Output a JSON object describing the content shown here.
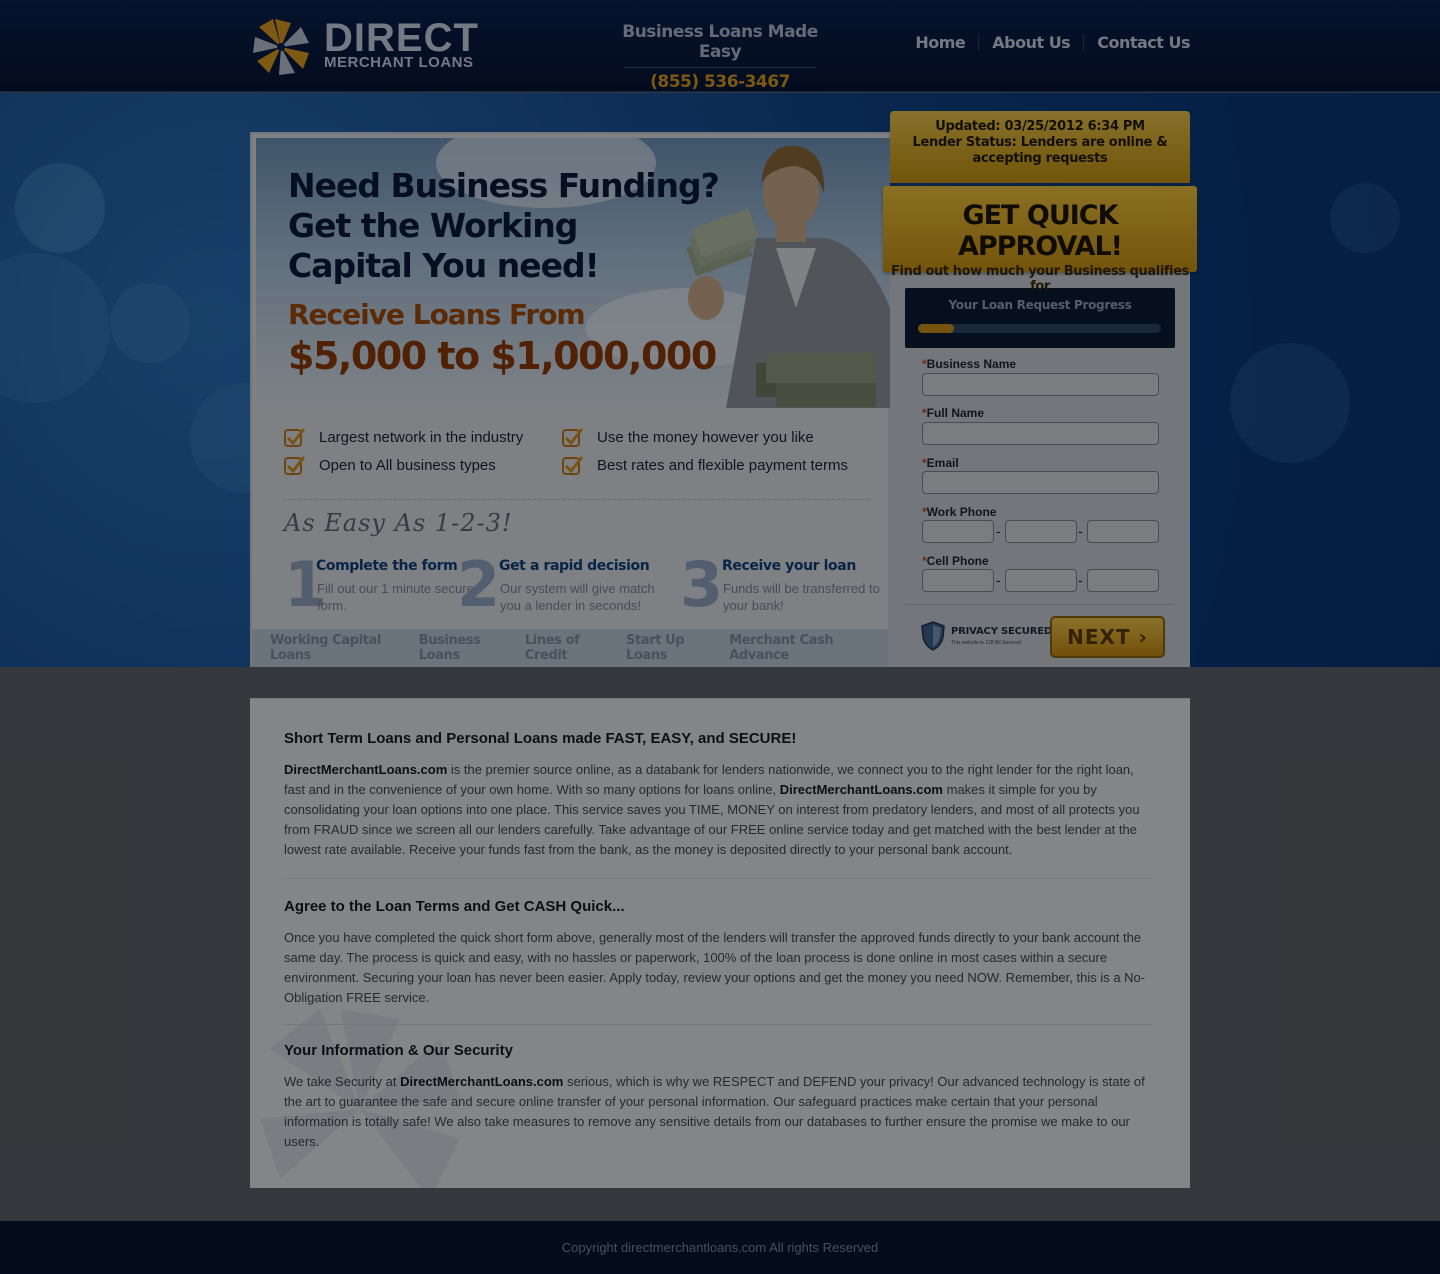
{
  "header": {
    "logo_title": "DIRECT",
    "logo_subtitle": "MERCHANT LOANS",
    "tagline": "Business Loans Made Easy",
    "phone": "(855) 536-3467",
    "nav": [
      "Home",
      "About Us",
      "Contact Us"
    ]
  },
  "hero": {
    "headline_1": "Need Business Funding?",
    "headline_2": "Get the Working",
    "headline_3": "Capital You need!",
    "receive": "Receive Loans From",
    "amount": "$5,000 to $1,000,000",
    "features": [
      "Largest network in the industry",
      "Use the money however you like",
      "Open to All business types",
      "Best rates and flexible payment terms"
    ],
    "easy": "As Easy As 1-2-3!",
    "steps": [
      {
        "num": "1",
        "title": "Complete the form",
        "desc": "Fill out our 1 minute secure form."
      },
      {
        "num": "2",
        "title": "Get a rapid decision",
        "desc": "Our system will give match you a lender in seconds!"
      },
      {
        "num": "3",
        "title": "Receive your loan",
        "desc": "Funds will be transferred to your bank!"
      }
    ],
    "loan_types": [
      "Working Capital Loans",
      "Business Loans",
      "Lines of Credit",
      "Start Up Loans",
      "Merchant Cash Advance"
    ]
  },
  "status": {
    "updated": "Updated: 03/25/2012 6:34 PM",
    "lender_1": "Lender Status: Lenders are online &",
    "lender_2": "accepting requests"
  },
  "approval": {
    "title": "GET QUICK APPROVAL!",
    "subtitle": "Find out how much your Business qualifies for"
  },
  "form": {
    "progress_title": "Your Loan Request Progress",
    "progress_value": 0.15,
    "required_mark": "*",
    "fields": {
      "business_name": "Business Name",
      "full_name": "Full Name",
      "email": "Email",
      "work_phone": "Work Phone",
      "cell_phone": "Cell Phone"
    },
    "phone_sep": "-",
    "privacy_title": "PRIVACY SECURED",
    "privacy_sub": "This website is 128 Bit Secured",
    "next_label": "NEXT ›"
  },
  "content": {
    "s1_title": "Short Term Loans and Personal Loans made FAST, EASY, and SECURE!",
    "site": "DirectMerchantLoans.com",
    "s1_p1": " is the premier source online, as a databank for lenders nationwide, we connect you to the right lender for the right loan, fast and in the convenience of your own home. With so many options for loans online, ",
    "s1_p2": " makes it simple for you by consolidating your loan options into one place. This service saves you TIME, MONEY on interest from predatory lenders, and most of all protects you from FRAUD since we screen all our lenders carefully. Take advantage of our FREE online service today and get matched with the best lender at the lowest rate available.  Receive your funds fast from the bank, as the money is deposited directly to your personal bank account.",
    "s2_title": "Agree to the Loan Terms and Get CASH Quick...",
    "s2_p": "Once you have completed the quick short form above, generally most of the lenders will transfer the approved funds directly to your bank account the same day. The process is quick and easy, with no hassles or paperwork, 100% of the loan process is done online in most cases within a secure environment. Securing your loan has never been easier. Apply today, review your options and get the money you need NOW. Remember, this is a No-Obligation FREE service.",
    "s3_title": "Your Information & Our Security",
    "s3_p1": "We take Security at ",
    "s3_p2": " serious, which is why we RESPECT and DEFEND your privacy! Our advanced technology is state of the art to guarantee the safe and secure online transfer of your personal information. Our safeguard practices make certain that your personal information is totally safe! We also take measures to remove any sensitive details from our databases to further ensure the promise we make to our users."
  },
  "footer": {
    "copyright": "Copyright directmerchantloans.com All rights Reserved"
  },
  "colors": {
    "header_bg": "#061533",
    "accent_gold": "#d49a1f",
    "hero_blue": "#0d3f82"
  }
}
